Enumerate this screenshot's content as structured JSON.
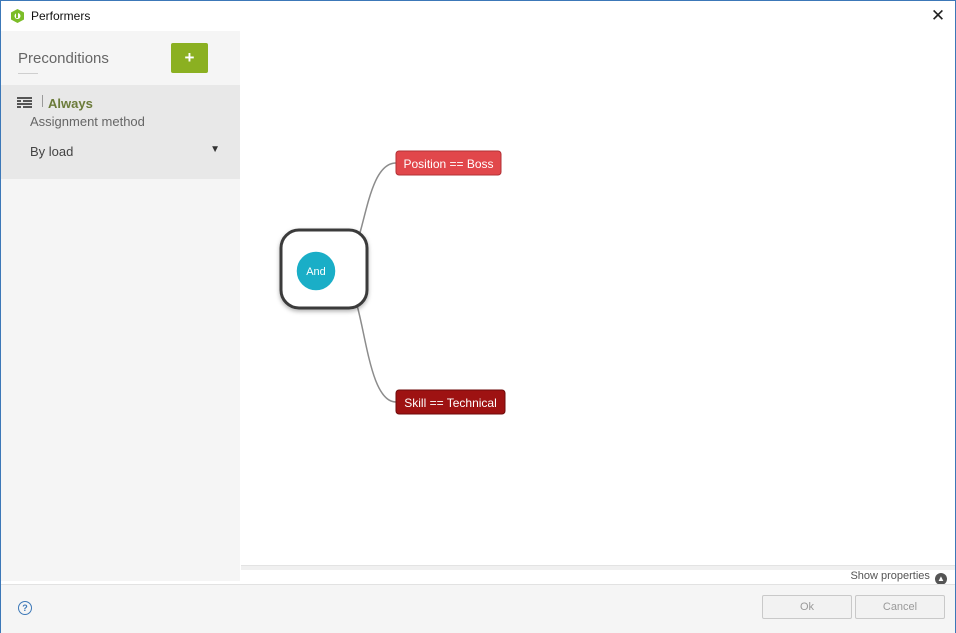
{
  "window": {
    "title": "Performers"
  },
  "sidebar": {
    "title": "Preconditions",
    "add_label": "+",
    "item": {
      "title": "Always",
      "subtitle": "Assignment method",
      "method_value": "By load"
    }
  },
  "diagram": {
    "root": {
      "label": "And",
      "color": "#1aaec7"
    },
    "children": [
      {
        "label": "Position == Boss",
        "color": "#e1474b"
      },
      {
        "label": "Skill == Technical",
        "color": "#9e1212"
      }
    ]
  },
  "footer": {
    "show_properties": "Show properties",
    "ok_label": "Ok",
    "cancel_label": "Cancel",
    "help_label": "?"
  },
  "colors": {
    "accent": "#8bb021",
    "border": "#3c78b8"
  }
}
